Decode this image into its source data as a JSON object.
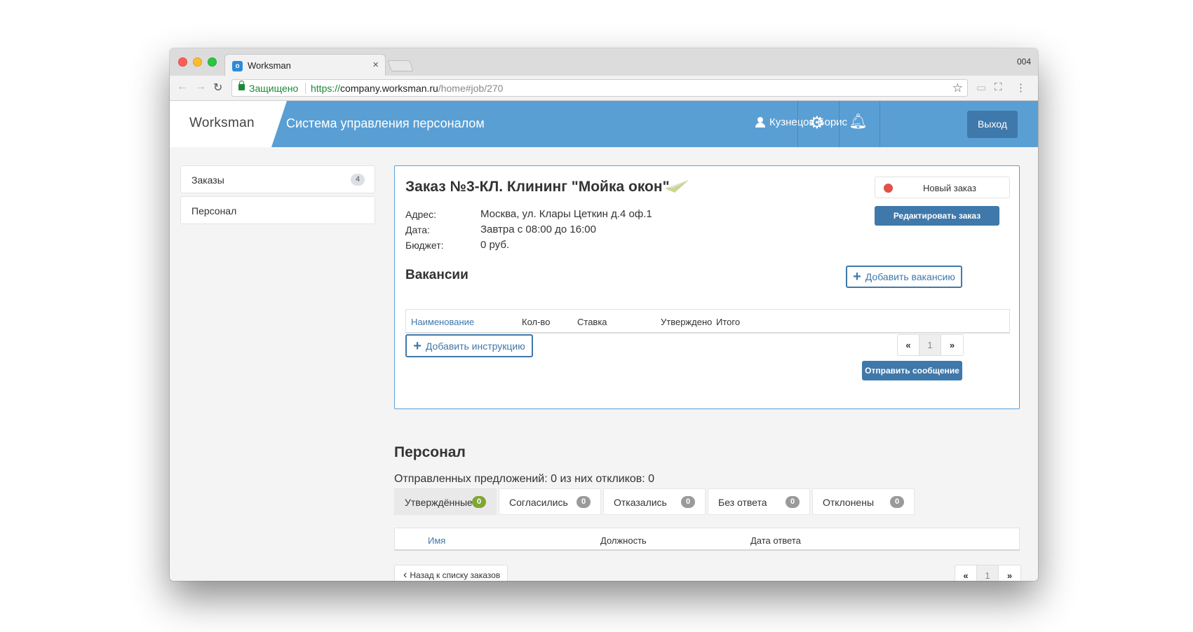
{
  "browser": {
    "tab_title": "Worksman",
    "tab_close": "×",
    "window_label": "004",
    "secure_label": "Защищено",
    "url_scheme": "https://",
    "url_host": "company.worksman.ru",
    "url_path": "/home#job/270"
  },
  "header": {
    "brand": "Worksman",
    "title": "Система управления персоналом",
    "user_name": "Кузнецов Борис",
    "logout_label": "Выход",
    "accent_color": "#5a9fd4"
  },
  "sidebar": {
    "items": [
      {
        "label": "Заказы",
        "badge": "4"
      },
      {
        "label": "Персонал",
        "badge": ""
      }
    ]
  },
  "order": {
    "title": "Заказ №3-КЛ. Клининг \"Мойка окон\"",
    "status": "Новый заказ",
    "status_color": "#e0524a",
    "edit_label": "Редактировать заказ",
    "fields": [
      {
        "label": "Адрес:",
        "value": "Москва, ул. Клары Цеткин д.4 оф.1"
      },
      {
        "label": "Дата:",
        "value": "Завтра с 08:00 до 16:00"
      },
      {
        "label": "Бюджет:",
        "value": "0 руб."
      }
    ],
    "vacancies_title": "Вакансии",
    "add_vacancy_label": "Добавить вакансию",
    "vacancy_columns": [
      "Наименование",
      "Кол-во",
      "Ставка",
      "Утверждено",
      "Итого"
    ],
    "add_instruction_label": "Добавить инструкцию",
    "pager": {
      "prev": "«",
      "page": "1",
      "next": "»"
    },
    "send_message_label": "Отправить сообщение"
  },
  "staff": {
    "title": "Персонал",
    "summary": "Отправленных предложений: 0 из них откликов: 0",
    "tabs": [
      {
        "label": "Утверждённые",
        "count": "0",
        "active": true
      },
      {
        "label": "Согласились",
        "count": "0",
        "active": false
      },
      {
        "label": "Отказались",
        "count": "0",
        "active": false
      },
      {
        "label": "Без ответа",
        "count": "0",
        "active": false
      },
      {
        "label": "Отклонены",
        "count": "0",
        "active": false
      }
    ],
    "columns": [
      "Имя",
      "Должность",
      "Дата ответа"
    ],
    "back_label": "Назад к списку заказов",
    "pager": {
      "prev": "«",
      "page": "1",
      "next": "»"
    }
  }
}
